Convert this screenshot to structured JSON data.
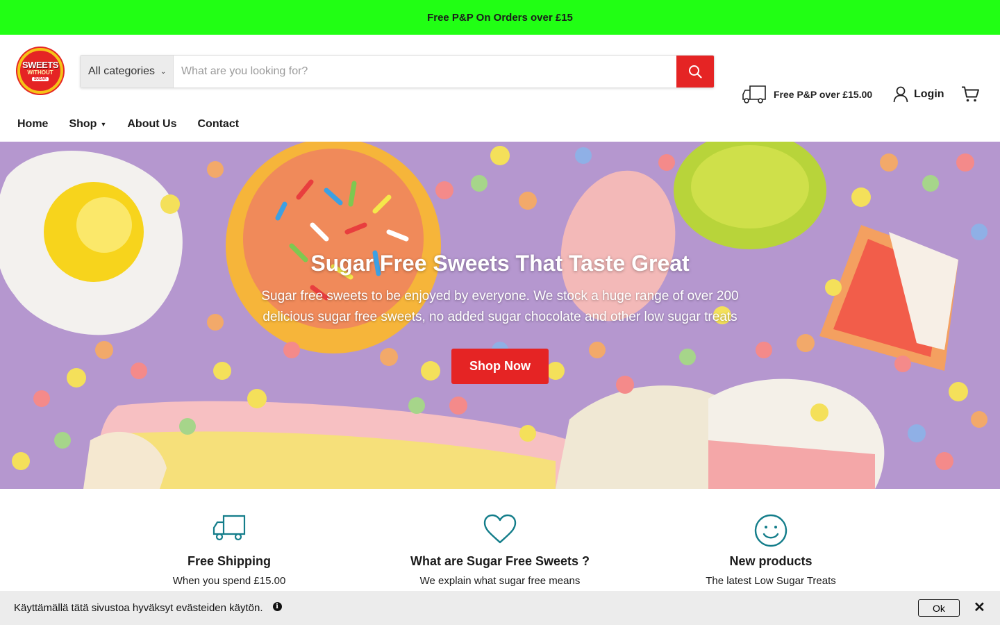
{
  "promo": {
    "text": "Free P&P On Orders over £15"
  },
  "logo": {
    "line1": "SWEETS",
    "line2": "WITHOUT",
    "line3": "SUGAR"
  },
  "search": {
    "category": "All categories",
    "placeholder": "What are you looking for?",
    "value": ""
  },
  "header": {
    "shipping_text": "Free P&P over £15.00",
    "login_label": "Login"
  },
  "nav": {
    "items": [
      {
        "label": "Home"
      },
      {
        "label": "Shop"
      },
      {
        "label": "About Us"
      },
      {
        "label": "Contact"
      }
    ]
  },
  "hero": {
    "title": "Sugar Free Sweets That Taste Great",
    "text": "Sugar free sweets to be enjoyed by everyone. We stock a huge range of over 200 delicious sugar free sweets, no added sugar chocolate and other low sugar treats",
    "button": "Shop Now"
  },
  "features": [
    {
      "icon": "truck-icon",
      "title": "Free Shipping",
      "subtitle": "When you spend £15.00"
    },
    {
      "icon": "heart-icon",
      "title": "What are Sugar Free Sweets ?",
      "subtitle": "We explain what sugar free means"
    },
    {
      "icon": "smiley-icon",
      "title": "New products",
      "subtitle": "The latest Low Sugar Treats"
    }
  ],
  "cookie": {
    "text": "Käyttämällä tätä sivustoa hyväksyt evästeiden käytön.",
    "ok_label": "Ok",
    "close_label": "✕"
  },
  "colors": {
    "promo_bg": "#21ff14",
    "accent_red": "#e52424",
    "feature_icon": "#137d8a",
    "hero_bg": "#b597cf",
    "cookie_bg": "#ececec"
  }
}
